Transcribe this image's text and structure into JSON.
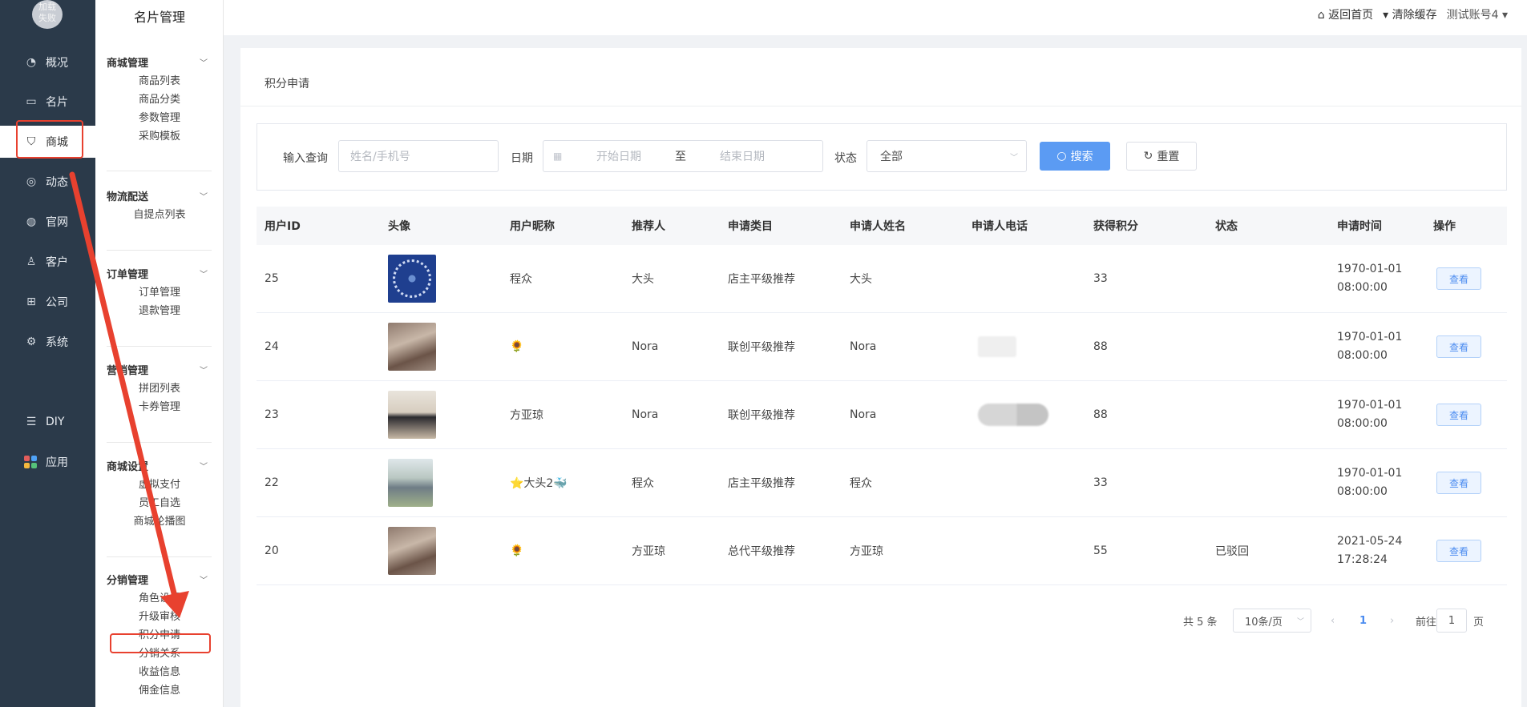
{
  "left_nav": {
    "logo_text": "加载\n失败",
    "items": [
      {
        "label": "概况",
        "icon": "pie-chart-icon"
      },
      {
        "label": "名片",
        "icon": "card-icon"
      },
      {
        "label": "商城",
        "icon": "shopping-bag-icon"
      },
      {
        "label": "动态",
        "icon": "compass-icon"
      },
      {
        "label": "官网",
        "icon": "globe-icon"
      },
      {
        "label": "客户",
        "icon": "user-icon"
      },
      {
        "label": "公司",
        "icon": "org-icon"
      },
      {
        "label": "系统",
        "icon": "gear-icon"
      },
      {
        "label": "DIY",
        "icon": "diy-icon"
      },
      {
        "label": "应用",
        "icon": "apps-icon"
      }
    ]
  },
  "sub_nav": {
    "title": "名片管理",
    "groups": [
      {
        "title": "商城管理",
        "items": [
          "商品列表",
          "商品分类",
          "参数管理",
          "采购模板"
        ]
      },
      {
        "title": "物流配送",
        "items": [
          "自提点列表"
        ]
      },
      {
        "title": "订单管理",
        "items": [
          "订单管理",
          "退款管理"
        ]
      },
      {
        "title": "营销管理",
        "items": [
          "拼团列表",
          "卡券管理"
        ]
      },
      {
        "title": "商城设置",
        "items": [
          "虚拟支付",
          "员工自选",
          "商城轮播图"
        ]
      },
      {
        "title": "分销管理",
        "items": [
          "角色设置",
          "升级审核",
          "积分申请",
          "分销关系",
          "收益信息",
          "佣金信息"
        ]
      }
    ]
  },
  "topbar": {
    "home": "返回首页",
    "clear_cache": "清除缓存",
    "account": "测试账号4"
  },
  "page": {
    "breadcrumb": "积分申请"
  },
  "filter": {
    "query_label": "输入查询",
    "query_placeholder": "姓名/手机号",
    "date_label": "日期",
    "start_placeholder": "开始日期",
    "range_sep": "至",
    "end_placeholder": "结束日期",
    "status_label": "状态",
    "status_value": "全部",
    "search_btn": "搜索",
    "reset_btn": "重置"
  },
  "table": {
    "columns": [
      "用户ID",
      "头像",
      "用户昵称",
      "推荐人",
      "申请类目",
      "申请人姓名",
      "申请人电话",
      "获得积分",
      "状态",
      "申请时间",
      "操作"
    ],
    "rows": [
      {
        "id": "25",
        "nickname": "程众",
        "referrer": "大头",
        "category": "店主平级推荐",
        "name": "大头",
        "points": "33",
        "status": "",
        "date": "1970-01-01",
        "time": "08:00:00",
        "action": "查看"
      },
      {
        "id": "24",
        "nickname": "🌻",
        "referrer": "Nora",
        "category": "联创平级推荐",
        "name": "Nora",
        "points": "88",
        "status": "",
        "date": "1970-01-01",
        "time": "08:00:00",
        "action": "查看"
      },
      {
        "id": "23",
        "nickname": "方亚琼",
        "referrer": "Nora",
        "category": "联创平级推荐",
        "name": "Nora",
        "points": "88",
        "status": "",
        "date": "1970-01-01",
        "time": "08:00:00",
        "action": "查看"
      },
      {
        "id": "22",
        "nickname": "⭐大头2🐳",
        "referrer": "程众",
        "category": "店主平级推荐",
        "name": "程众",
        "points": "33",
        "status": "",
        "date": "1970-01-01",
        "time": "08:00:00",
        "action": "查看"
      },
      {
        "id": "20",
        "nickname": "🌻",
        "referrer": "方亚琼",
        "category": "总代平级推荐",
        "name": "方亚琼",
        "points": "55",
        "status": "已驳回",
        "date": "2021-05-24",
        "time": "17:28:24",
        "action": "查看"
      }
    ]
  },
  "pager": {
    "total": "共 5 条",
    "page_size": "10条/页",
    "current": "1",
    "goto_prefix": "前往",
    "goto_value": "1",
    "goto_suffix": "页"
  },
  "colors": {
    "nav_bg": "#2b3a4a",
    "accent": "#5b9bf3",
    "annotation": "#e8412f"
  }
}
